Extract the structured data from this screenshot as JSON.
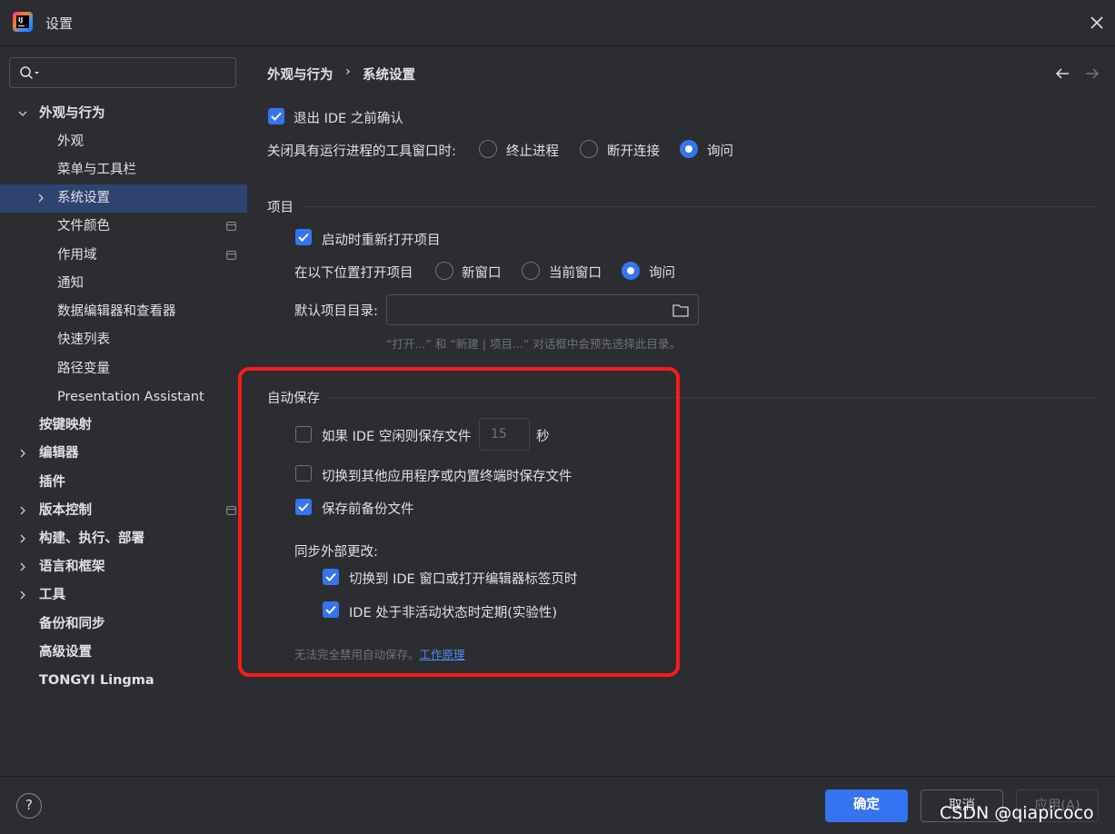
{
  "window": {
    "title": "设置",
    "app_icon": "intellij-idea-icon",
    "app_icon_text": "IJ"
  },
  "sidebar": {
    "search": {
      "placeholder": "",
      "value": ""
    },
    "items": [
      {
        "label": "外观与行为",
        "level": 0,
        "expanded": true,
        "bold": true
      },
      {
        "label": "外观",
        "level": 1
      },
      {
        "label": "菜单与工具栏",
        "level": 1
      },
      {
        "label": "系统设置",
        "level": 1,
        "selected": true,
        "collapsed": true
      },
      {
        "label": "文件颜色",
        "level": 1,
        "badge": "project-scope-icon"
      },
      {
        "label": "作用域",
        "level": 1,
        "badge": "project-scope-icon"
      },
      {
        "label": "通知",
        "level": 1
      },
      {
        "label": "数据编辑器和查看器",
        "level": 1
      },
      {
        "label": "快速列表",
        "level": 1
      },
      {
        "label": "路径变量",
        "level": 1
      },
      {
        "label": "Presentation Assistant",
        "level": 1
      },
      {
        "label": "按键映射",
        "level": 0,
        "bold": true
      },
      {
        "label": "编辑器",
        "level": 0,
        "bold": true,
        "collapsed": true
      },
      {
        "label": "插件",
        "level": 0,
        "bold": true
      },
      {
        "label": "版本控制",
        "level": 0,
        "bold": true,
        "collapsed": true,
        "badge": "project-scope-icon"
      },
      {
        "label": "构建、执行、部署",
        "level": 0,
        "bold": true,
        "collapsed": true
      },
      {
        "label": "语言和框架",
        "level": 0,
        "bold": true,
        "collapsed": true
      },
      {
        "label": "工具",
        "level": 0,
        "bold": true,
        "collapsed": true
      },
      {
        "label": "备份和同步",
        "level": 0,
        "bold": true
      },
      {
        "label": "高级设置",
        "level": 0,
        "bold": true
      },
      {
        "label": "TONGYI Lingma",
        "level": 0,
        "bold": true
      }
    ]
  },
  "header": {
    "breadcrumb": [
      "外观与行为",
      "系统设置"
    ],
    "breadcrumb_sep": "›"
  },
  "general": {
    "confirm_exit": {
      "label": "退出 IDE 之前确认",
      "checked": true
    },
    "close_tool_window": {
      "label": "关闭具有运行进程的工具窗口时:",
      "options": [
        "终止进程",
        "断开连接",
        "询问"
      ],
      "selected": "询问"
    }
  },
  "project": {
    "title": "项目",
    "reopen": {
      "label": "启动时重新打开项目",
      "checked": true
    },
    "open_location": {
      "label": "在以下位置打开项目",
      "options": [
        "新窗口",
        "当前窗口",
        "询问"
      ],
      "selected": "询问"
    },
    "default_dir": {
      "label": "默认项目目录:",
      "value": ""
    },
    "hint": "“打开...” 和 “新建 | 项目...” 对话框中会预先选择此目录。"
  },
  "autosave": {
    "title": "自动保存",
    "idle": {
      "label": "如果 IDE 空闲则保存文件",
      "checked": false,
      "seconds": "15",
      "unit": "秒"
    },
    "frame_deactivate": {
      "label": "切换到其他应用程序或内置终端时保存文件",
      "checked": false
    },
    "backup": {
      "label": "保存前备份文件",
      "checked": true
    },
    "sync_title": "同步外部更改:",
    "sync_on_switch": {
      "label": "切换到 IDE 窗口或打开编辑器标签页时",
      "checked": true
    },
    "sync_periodic": {
      "label": "IDE 处于非活动状态时定期(实验性)",
      "checked": true
    },
    "note": "无法完全禁用自动保存。",
    "note_link": "工作原理"
  },
  "footer": {
    "help": "?",
    "ok": "确定",
    "cancel": "取消",
    "apply": "应用(A)"
  },
  "watermark": "CSDN @qiapicoco",
  "colors": {
    "background": "#2b2d30",
    "accent": "#3574f0",
    "selection": "#2e436e",
    "annotation": "#ff1a1a",
    "link": "#548af7"
  }
}
